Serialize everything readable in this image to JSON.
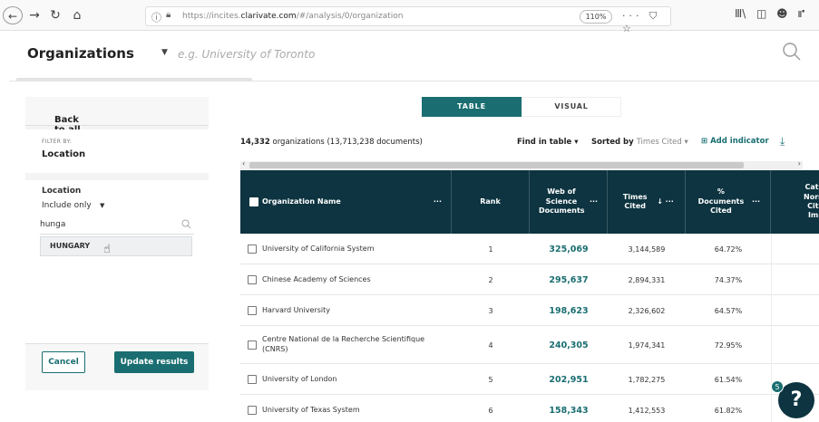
{
  "browser": {
    "url_prefix": "https://incites.",
    "url_domain": "clarivate.com",
    "url_path": "/#/analysis/0/organization",
    "zoom": "110%",
    "page_actions": "··· ⛉ ☆",
    "right_tools": [
      "Ⅲ\\",
      "◫",
      "☻",
      "⑈"
    ]
  },
  "header": {
    "entity": "Organizations",
    "search_placeholder": "e.g. University of Toronto"
  },
  "filters": {
    "back_label": "Back to all filters",
    "filter_by_label": "FILTER BY:",
    "filter_name": "Location",
    "location_label": "Location",
    "include_mode": "Include only",
    "search_value": "hunga",
    "suggestion": "HUNGARY",
    "cancel_label": "Cancel",
    "update_label": "Update results"
  },
  "view_tabs": {
    "table": "TABLE",
    "visual": "VISUAL"
  },
  "toolbar": {
    "count": "14,332",
    "summary_rest": " organizations (13,713,238 documents)",
    "find_in_table": "Find in table ▾",
    "sorted_by_label": "Sorted by ",
    "sorted_by_value": "Times Cited ▾",
    "add_indicator": "Add indicator"
  },
  "table": {
    "headers": {
      "name": "Organization Name",
      "rank": "Rank",
      "wos": "Web of Science Documents",
      "cited": "Times Cited",
      "pct": "% Documents Cited",
      "cat": "Cate Norm Cita Imp"
    },
    "rows": [
      {
        "name": "University of California System",
        "rank": "1",
        "wos": "325,069",
        "cited": "3,144,589",
        "pct": "64.72%"
      },
      {
        "name": "Chinese Academy of Sciences",
        "rank": "2",
        "wos": "295,637",
        "cited": "2,894,331",
        "pct": "74.37%"
      },
      {
        "name": "Harvard University",
        "rank": "3",
        "wos": "198,623",
        "cited": "2,326,602",
        "pct": "64.57%"
      },
      {
        "name": "Centre National de la Recherche Scientifique (CNRS)",
        "rank": "4",
        "wos": "240,305",
        "cited": "1,974,341",
        "pct": "72.95%"
      },
      {
        "name": "University of London",
        "rank": "5",
        "wos": "202,951",
        "cited": "1,782,275",
        "pct": "61.54%"
      },
      {
        "name": "University of Texas System",
        "rank": "6",
        "wos": "158,343",
        "cited": "1,412,553",
        "pct": "61.82%"
      }
    ]
  },
  "help": {
    "label": "?",
    "badge": "5"
  }
}
